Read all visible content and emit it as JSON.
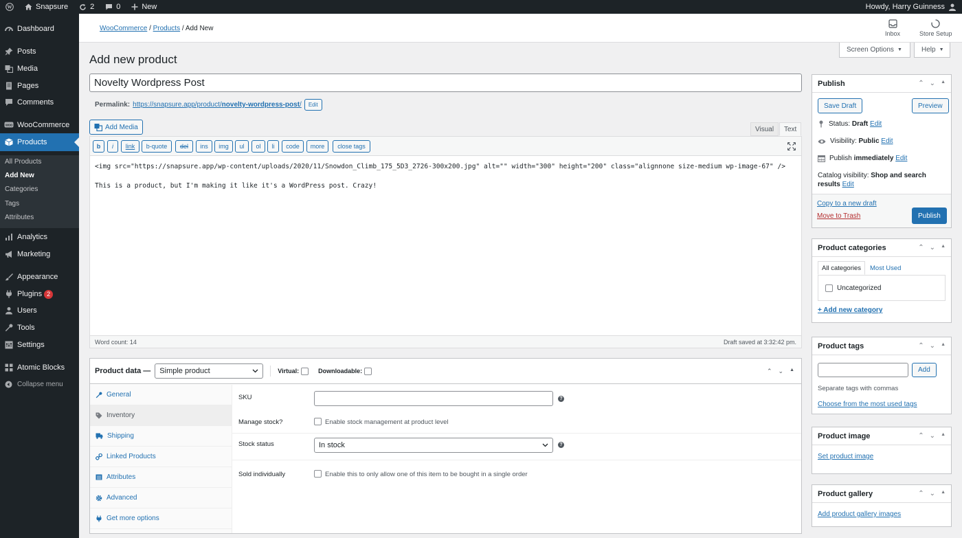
{
  "adminbar": {
    "site_name": "Snapsure",
    "updates_count": "2",
    "comments_count": "0",
    "new_label": "New",
    "howdy": "Howdy, Harry Guinness"
  },
  "sidebar": {
    "items": [
      {
        "label": "Dashboard"
      },
      {
        "label": "Posts"
      },
      {
        "label": "Media"
      },
      {
        "label": "Pages"
      },
      {
        "label": "Comments"
      },
      {
        "label": "WooCommerce"
      },
      {
        "label": "Products"
      },
      {
        "label": "Analytics"
      },
      {
        "label": "Marketing"
      },
      {
        "label": "Appearance"
      },
      {
        "label": "Plugins"
      },
      {
        "label": "Users"
      },
      {
        "label": "Tools"
      },
      {
        "label": "Settings"
      },
      {
        "label": "Atomic Blocks"
      },
      {
        "label": "Collapse menu"
      }
    ],
    "plugins_badge": "2",
    "submenu": [
      {
        "label": "All Products"
      },
      {
        "label": "Add New"
      },
      {
        "label": "Categories"
      },
      {
        "label": "Tags"
      },
      {
        "label": "Attributes"
      }
    ]
  },
  "header": {
    "breadcrumb": [
      "WooCommerce",
      "Products",
      "Add New"
    ],
    "inbox_label": "Inbox",
    "store_setup_label": "Store Setup",
    "screen_options": "Screen Options",
    "help": "Help"
  },
  "page": {
    "title": "Add new product",
    "product_title": "Novelty Wordpress Post",
    "permalink_label": "Permalink:",
    "permalink_base": "https://snapsure.app/product/",
    "permalink_slug": "novelty-wordpress-post",
    "permalink_trail": "/",
    "permalink_edit": "Edit"
  },
  "editor": {
    "add_media": "Add Media",
    "tab_visual": "Visual",
    "tab_text": "Text",
    "quicktags": [
      "b",
      "i",
      "link",
      "b-quote",
      "del",
      "ins",
      "img",
      "ul",
      "ol",
      "li",
      "code",
      "more",
      "close tags"
    ],
    "line1": "<img src=\"https://snapsure.app/wp-content/uploads/2020/11/Snowdon_Climb_175_5D3_2726-300x200.jpg\" alt=\"\" width=\"300\" height=\"200\" class=\"alignnone size-medium wp-image-67\" />",
    "line2": "This is a product, but I'm making it like it's a WordPress post. Crazy!",
    "word_count": "Word count: 14",
    "draft_saved": "Draft saved at 3:32:42 pm."
  },
  "product_data": {
    "label": "Product data —",
    "type": "Simple product",
    "virtual_label": "Virtual:",
    "downloadable_label": "Downloadable:",
    "tabs": [
      {
        "label": "General"
      },
      {
        "label": "Inventory"
      },
      {
        "label": "Shipping"
      },
      {
        "label": "Linked Products"
      },
      {
        "label": "Attributes"
      },
      {
        "label": "Advanced"
      },
      {
        "label": "Get more options"
      }
    ],
    "sku_label": "SKU",
    "manage_stock_label": "Manage stock?",
    "manage_stock_text": "Enable stock management at product level",
    "stock_status_label": "Stock status",
    "stock_status_value": "In stock",
    "sold_individually_label": "Sold individually",
    "sold_individually_text": "Enable this to only allow one of this item to be bought in a single order"
  },
  "publish": {
    "title": "Publish",
    "save_draft": "Save Draft",
    "preview": "Preview",
    "status_label": "Status:",
    "status_value": "Draft",
    "visibility_label": "Visibility:",
    "visibility_value": "Public",
    "publish_label": "Publish",
    "publish_value": "immediately",
    "edit": "Edit",
    "catalog_label": "Catalog visibility:",
    "catalog_value_1": "Shop and search",
    "catalog_value_2": "results",
    "copy_draft": "Copy to a new draft",
    "trash": "Move to Trash",
    "publish_button": "Publish"
  },
  "categories": {
    "title": "Product categories",
    "tab_all": "All categories",
    "tab_most_used": "Most Used",
    "item": "Uncategorized",
    "add_new": "+ Add new category"
  },
  "tags": {
    "title": "Product tags",
    "add": "Add",
    "hint": "Separate tags with commas",
    "choose": "Choose from the most used tags"
  },
  "product_image": {
    "title": "Product image",
    "link": "Set product image"
  },
  "gallery": {
    "title": "Product gallery",
    "link": "Add product gallery images"
  },
  "colors": {
    "admin_dark": "#1d2327",
    "accent": "#2271b1",
    "trash": "#b32d2e",
    "badge": "#d63638"
  }
}
